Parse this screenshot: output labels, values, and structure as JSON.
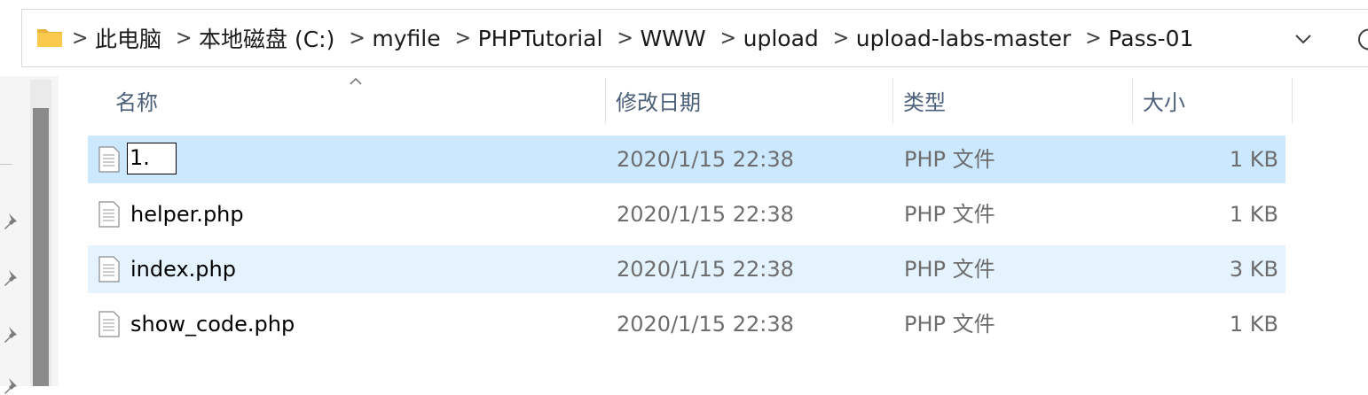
{
  "address_bar": {
    "breadcrumbs": [
      "此电脑",
      "本地磁盘 (C:)",
      "myfile",
      "PHPTutorial",
      "WWW",
      "upload",
      "upload-labs-master",
      "Pass-01"
    ],
    "separator": ">"
  },
  "columns": {
    "name": "名称",
    "date": "修改日期",
    "type": "类型",
    "size": "大小"
  },
  "files": [
    {
      "name": "1.",
      "date": "2020/1/15 22:38",
      "type": "PHP 文件",
      "size": "1 KB",
      "state": "selected-renaming"
    },
    {
      "name": "helper.php",
      "date": "2020/1/15 22:38",
      "type": "PHP 文件",
      "size": "1 KB",
      "state": "normal"
    },
    {
      "name": "index.php",
      "date": "2020/1/15 22:38",
      "type": "PHP 文件",
      "size": "3 KB",
      "state": "hover"
    },
    {
      "name": "show_code.php",
      "date": "2020/1/15 22:38",
      "type": "PHP 文件",
      "size": "1 KB",
      "state": "normal"
    }
  ],
  "icons": {
    "folder": "folder-icon",
    "file": "document-icon",
    "pin": "pin-icon",
    "dropdown": "chevron-down-icon",
    "refresh": "refresh-icon"
  },
  "colors": {
    "selected_row": "#cce8ff",
    "hover_row": "#e5f3ff",
    "header_text": "#4c607a",
    "folder": "#f8c94b"
  }
}
